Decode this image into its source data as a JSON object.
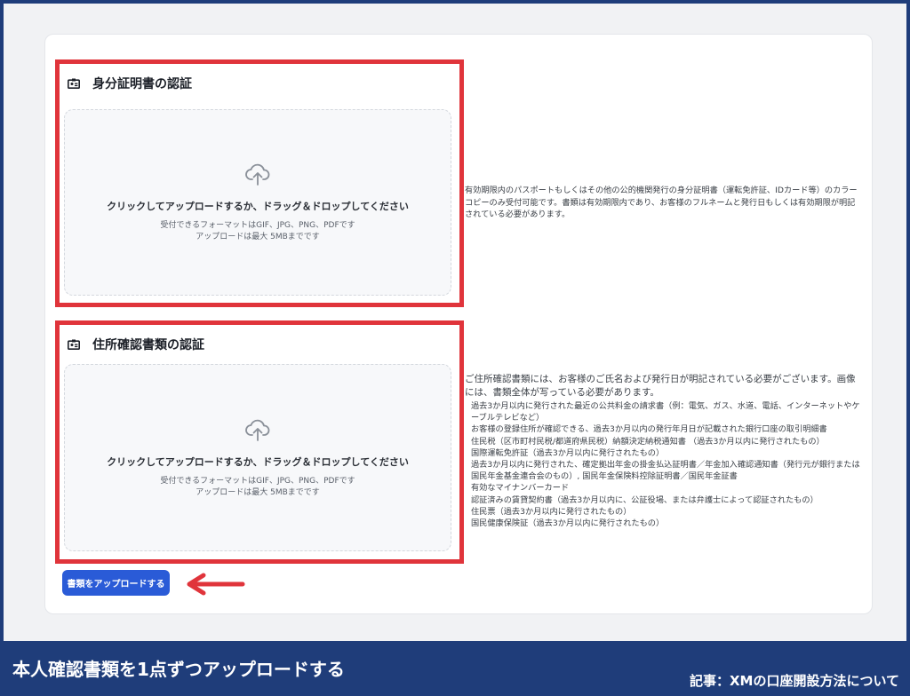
{
  "sections": [
    {
      "title": "身分証明書の認証",
      "dropzone": {
        "main": "クリックしてアップロードするか、ドラッグ＆ドロップしてください",
        "formats": "受付できるフォーマットはGIF、JPG、PNG、PDFです",
        "max_size": "アップロードは最大 5MBまでです"
      },
      "description": "有効期限内のパスポートもしくはその他の公的機関発行の身分証明書（運転免許証、IDカード等）のカラーコピーのみ受付可能です。書類は有効期限内であり、お客様のフルネームと発行日もしくは有効期限が明記されている必要があります。"
    },
    {
      "title": "住所確認書類の認証",
      "dropzone": {
        "main": "クリックしてアップロードするか、ドラッグ＆ドロップしてください",
        "formats": "受付できるフォーマットはGIF、JPG、PNG、PDFです",
        "max_size": "アップロードは最大 5MBまでです"
      },
      "description_lead": "ご住所確認書類には、お客様のご氏名および発行日が明記されている必要がございます。画像には、書類全体が写っている必要があります。",
      "list": [
        "過去3か月以内に発行された最近の公共料金の請求書（例：電気、ガス、水道、電話、インターネットやケーブルテレビなど）",
        "お客様の登録住所が確認できる、過去3か月以内の発行年月日が記載された銀行口座の取引明細書",
        "住民税（区市町村民税/都道府県民税）納額決定納税通知書 （過去3か月以内に発行されたもの）",
        "国際運転免許証（過去3か月以内に発行されたもの）",
        "過去3か月以内に発行された、確定拠出年金の掛金払込証明書／年金加入確認通知書（発行元が銀行または国民年金基金連合会のもの）, 国民年金保険料控除証明書／国民年金証書",
        "有効なマイナンバーカード",
        "認証済みの賃貸契約書（過去3か月以内に、公証役場、または弁護士によって認証されたもの）",
        "住民票（過去3か月以内に発行されたもの）",
        "国民健康保険証（過去3か月以内に発行されたもの）"
      ]
    }
  ],
  "upload_button": "書類をアップロードする",
  "caption": "本人確認書類を1点ずつアップロードする",
  "article_link": "記事：XMの口座開設方法について",
  "colors": {
    "frame": "#1f3d7a",
    "highlight": "#e0343b",
    "button": "#2a5bd7"
  },
  "icons": [
    "id-card-icon",
    "cloud-upload-icon",
    "arrow-left-icon"
  ]
}
